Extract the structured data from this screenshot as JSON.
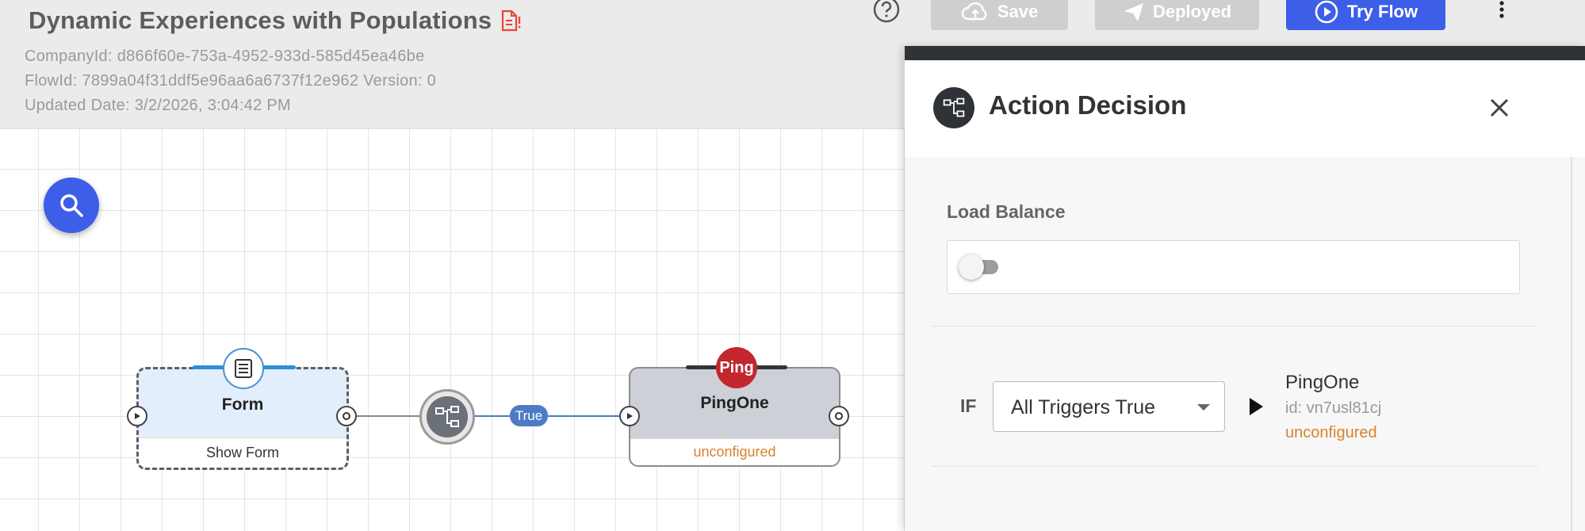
{
  "header": {
    "title": "Dynamic Experiences with Populations",
    "company_id": "CompanyId: d866f60e-753a-4952-933d-585d45ea46be",
    "flow_id": "FlowId: 7899a04f31ddf5e96aa6a6737f12e962 Version: 0",
    "updated": "Updated Date: 3/2/2026, 3:04:42 PM"
  },
  "toolbar": {
    "save_label": "Save",
    "deployed_label": "Deployed",
    "try_label": "Try Flow"
  },
  "canvas": {
    "form_node": {
      "title": "Form",
      "subtitle": "Show Form"
    },
    "connector_label": "True",
    "ping_node": {
      "logo": "Ping",
      "title": "PingOne",
      "status": "unconfigured"
    }
  },
  "panel": {
    "title": "Action Decision",
    "load_balance_label": "Load Balance",
    "load_balance_on": false,
    "if_label": "IF",
    "trigger_mode": "All Triggers True",
    "target": {
      "name": "PingOne",
      "id": "id: vn7usl81cj",
      "status": "unconfigured"
    }
  },
  "colors": {
    "primary": "#3c5ee8",
    "warning": "#d9822b",
    "ping_red": "#c3262e"
  }
}
